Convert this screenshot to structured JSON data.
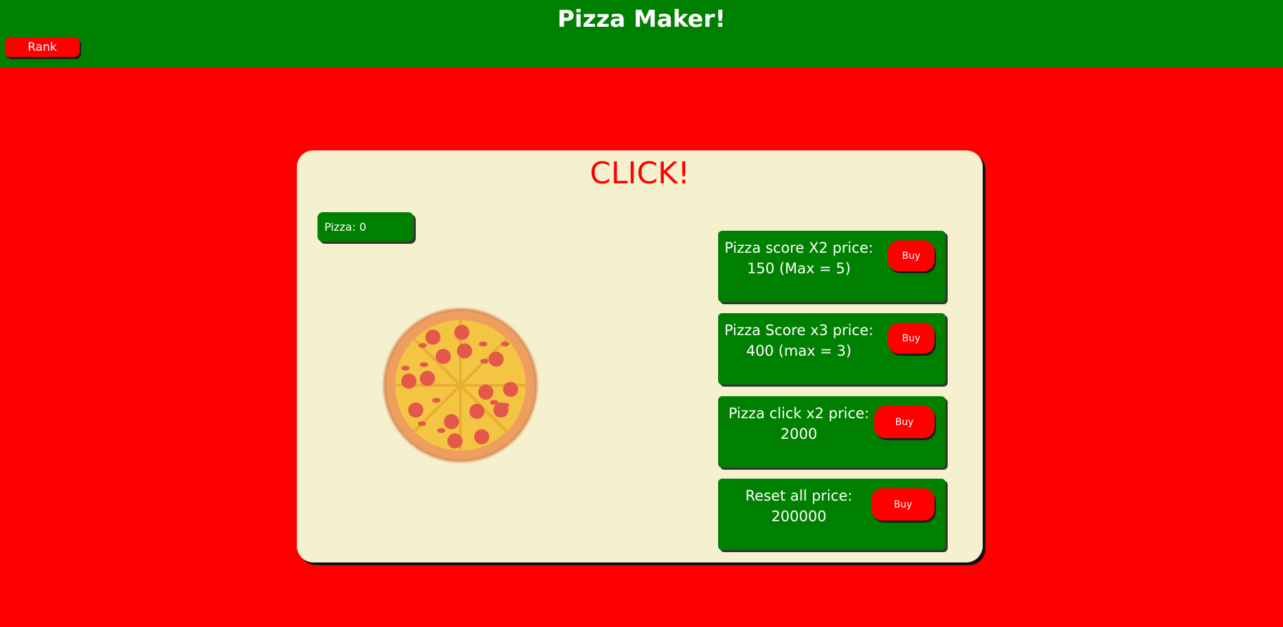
{
  "header": {
    "title": "Pizza Maker!",
    "rank_label": "Rank"
  },
  "game": {
    "click_title": "CLICK!",
    "pizza_count_label": "Pizza: 0",
    "pizza_image": "pizza-image"
  },
  "shop": {
    "items": [
      {
        "text": "Pizza score X2 price: 150 (Max = 5)",
        "buy_label": "Buy"
      },
      {
        "text": "Pizza Score x3 price: 400 (max = 3)",
        "buy_label": "Buy"
      },
      {
        "text": "Pizza click x2 price: 2000",
        "buy_label": "Buy"
      },
      {
        "text": "Reset all price: 200000",
        "buy_label": "Buy"
      }
    ]
  },
  "colors": {
    "background": "#ff0000",
    "header": "#008000",
    "card": "#f5f0cd",
    "button": "#ff0000",
    "panel": "#008000"
  }
}
